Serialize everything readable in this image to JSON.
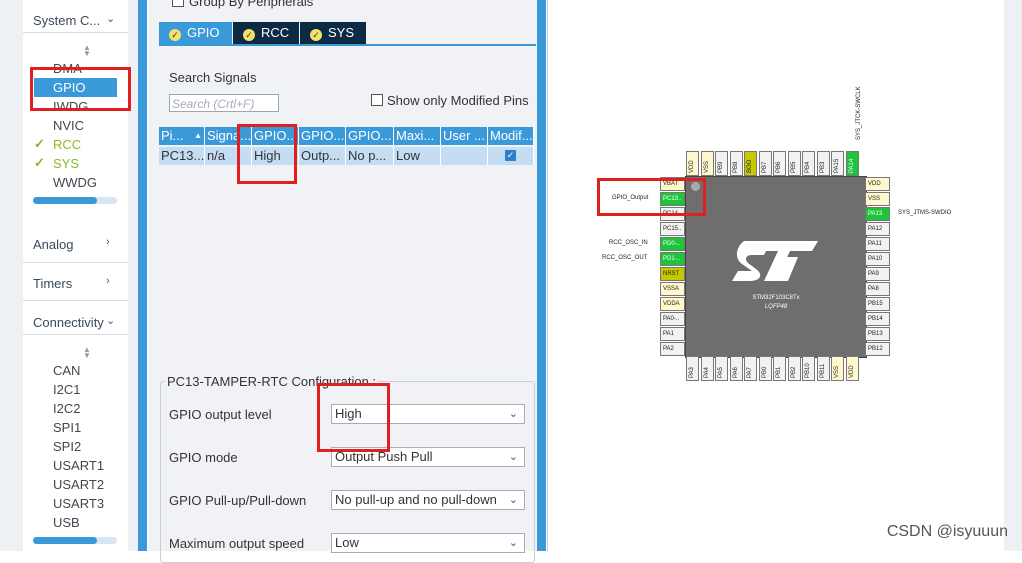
{
  "sidebar": {
    "system_core": {
      "label": "System C..."
    },
    "system_items": [
      {
        "label": "DMA",
        "checked": false
      },
      {
        "label": "GPIO",
        "checked": false,
        "selected": true
      },
      {
        "label": "IWDG",
        "checked": false
      },
      {
        "label": "NVIC",
        "checked": false
      },
      {
        "label": "RCC",
        "checked": true
      },
      {
        "label": "SYS",
        "checked": true
      },
      {
        "label": "WWDG",
        "checked": false
      }
    ],
    "analog": {
      "label": "Analog"
    },
    "timers": {
      "label": "Timers"
    },
    "connectivity": {
      "label": "Connectivity"
    },
    "connectivity_items": [
      {
        "label": "CAN"
      },
      {
        "label": "I2C1"
      },
      {
        "label": "I2C2"
      },
      {
        "label": "SPI1"
      },
      {
        "label": "SPI2"
      },
      {
        "label": "USART1"
      },
      {
        "label": "USART2"
      },
      {
        "label": "USART3"
      },
      {
        "label": "USB"
      }
    ]
  },
  "mode": {
    "group_by_peripherals": "Group By Peripherals",
    "tabs": [
      {
        "label": "GPIO",
        "active": true
      },
      {
        "label": "RCC"
      },
      {
        "label": "SYS"
      }
    ],
    "search_signals": "Search Signals",
    "search_placeholder": "Search (Crtl+F)",
    "show_only_modified": "Show only Modified Pins",
    "table": {
      "headers": [
        "Pi...",
        "Signa...",
        "GPIO...",
        "GPIO...",
        "GPIO...",
        "Maxi...",
        "User ...",
        "Modif..."
      ],
      "rows": [
        {
          "pin": "PC13...",
          "signal": "n/a",
          "output_level": "High",
          "mode": "Outp...",
          "pull": "No p...",
          "speed": "Low",
          "user_label": "",
          "modified": true
        }
      ]
    },
    "config": {
      "title": "PC13-TAMPER-RTC Configuration :",
      "fields": [
        {
          "label": "GPIO output level",
          "value": "High"
        },
        {
          "label": "GPIO mode",
          "value": "Output Push Pull"
        },
        {
          "label": "GPIO Pull-up/Pull-down",
          "value": "No pull-up and no pull-down"
        },
        {
          "label": "Maximum output speed",
          "value": "Low"
        }
      ]
    }
  },
  "pinout": {
    "chip": {
      "name": "STM32F103C8Tx",
      "package": "LQFP48"
    },
    "top_pins": [
      {
        "name": "VDD",
        "state": "yellow"
      },
      {
        "name": "VSS",
        "state": "yellow"
      },
      {
        "name": "PB9",
        "state": "none"
      },
      {
        "name": "PB8",
        "state": "none"
      },
      {
        "name": "BOO",
        "state": "olive"
      },
      {
        "name": "PB7",
        "state": "none"
      },
      {
        "name": "PB6",
        "state": "none"
      },
      {
        "name": "PB5",
        "state": "none"
      },
      {
        "name": "PB4",
        "state": "none"
      },
      {
        "name": "PB3",
        "state": "none"
      },
      {
        "name": "PA15",
        "state": "none"
      },
      {
        "name": "PA14",
        "state": "green"
      }
    ],
    "left_pins": [
      {
        "name": "VBAT",
        "state": "yellow"
      },
      {
        "name": "PC13..",
        "state": "green"
      },
      {
        "name": "PC14..",
        "state": "none"
      },
      {
        "name": "PC15..",
        "state": "none"
      },
      {
        "name": "PD0-..",
        "state": "green"
      },
      {
        "name": "PD1-..",
        "state": "green"
      },
      {
        "name": "NRST",
        "state": "olive"
      },
      {
        "name": "VSSA",
        "state": "yellow"
      },
      {
        "name": "VDDA",
        "state": "yellow"
      },
      {
        "name": "PA0-..",
        "state": "none"
      },
      {
        "name": "PA1",
        "state": "none"
      },
      {
        "name": "PA2",
        "state": "none"
      }
    ],
    "right_pins": [
      {
        "name": "VDD",
        "state": "yellow"
      },
      {
        "name": "VSS",
        "state": "yellow"
      },
      {
        "name": "PA13",
        "state": "green"
      },
      {
        "name": "PA12",
        "state": "none"
      },
      {
        "name": "PA11",
        "state": "none"
      },
      {
        "name": "PA10",
        "state": "none"
      },
      {
        "name": "PA9",
        "state": "none"
      },
      {
        "name": "PA8",
        "state": "none"
      },
      {
        "name": "PB15",
        "state": "none"
      },
      {
        "name": "PB14",
        "state": "none"
      },
      {
        "name": "PB13",
        "state": "none"
      },
      {
        "name": "PB12",
        "state": "none"
      }
    ],
    "bottom_pins": [
      {
        "name": "PA3",
        "state": "none"
      },
      {
        "name": "PA4",
        "state": "none"
      },
      {
        "name": "PA5",
        "state": "none"
      },
      {
        "name": "PA6",
        "state": "none"
      },
      {
        "name": "PA7",
        "state": "none"
      },
      {
        "name": "PB0",
        "state": "none"
      },
      {
        "name": "PB1",
        "state": "none"
      },
      {
        "name": "PB2",
        "state": "none"
      },
      {
        "name": "PB10",
        "state": "none"
      },
      {
        "name": "PB11",
        "state": "none"
      },
      {
        "name": "VSS",
        "state": "yellow"
      },
      {
        "name": "VDD",
        "state": "yellow"
      }
    ],
    "labels": {
      "gpio_output": "GPIO_Output",
      "rcc_osc_in": "RCC_OSC_IN",
      "rcc_osc_out": "RCC_OSC_OUT",
      "sys_swdio": "SYS_JTMS-SWDIO",
      "sys_swclk": "SYS_JTCK-SWCLK"
    }
  },
  "watermark": "CSDN @isyuuun",
  "colors": {
    "accent": "#3a9ad9",
    "annotation": "#e02020",
    "pin_green": "#1ec43a"
  }
}
